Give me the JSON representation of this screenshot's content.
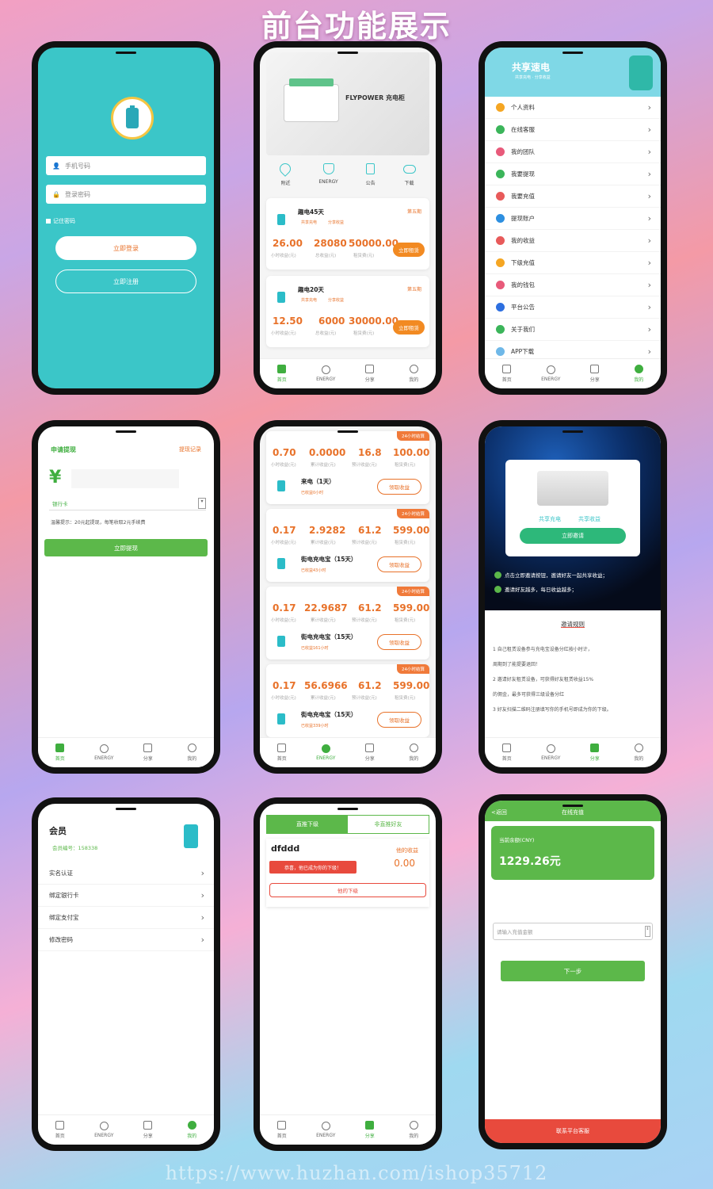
{
  "title": "前台功能展示",
  "watermark": "https://www.huzhan.com/ishop35712",
  "colors": {
    "teal": "#3bc6c8",
    "green": "#5cb84a",
    "orange": "#e8722a",
    "red": "#e84a3d"
  },
  "tabs": [
    "首页",
    "ENERGY",
    "分享",
    "我的"
  ],
  "login": {
    "phone_placeholder": "手机号码",
    "password_placeholder": "登录密码",
    "remember": "记住密码",
    "login_btn": "立即登录",
    "register_btn": "立即注册"
  },
  "home": {
    "banner_brand": "FLYPOWER 充电柜",
    "nav": [
      "附近",
      "ENERGY",
      "公告",
      "下载"
    ],
    "products": [
      {
        "name": "趣电45天",
        "tags": [
          "共享充电",
          "分享收益"
        ],
        "level": "第五期",
        "v1": "26.00",
        "v2": "28080",
        "v3": "50000.00",
        "l1": "小时收益(元)",
        "l2": "总收益(元)",
        "l3": "租赁费(元)",
        "btn": "立即租赁"
      },
      {
        "name": "趣电20天",
        "tags": [
          "共享充电",
          "分享收益"
        ],
        "level": "第五期",
        "v1": "12.50",
        "v2": "6000",
        "v3": "30000.00",
        "l1": "小时收益(元)",
        "l2": "总收益(元)",
        "l3": "租赁费(元)",
        "btn": "立即租赁"
      }
    ]
  },
  "profile": {
    "brand": "共享速电",
    "brand_sub": "共享充电 · 分享收益",
    "menu": [
      "个人资料",
      "在线客服",
      "我的团队",
      "我要提现",
      "我要充值",
      "提现账户",
      "我的收益",
      "下级充值",
      "我的钱包",
      "平台公告",
      "关于我们",
      "APP下载"
    ]
  },
  "withdraw": {
    "title": "申请提现",
    "record": "提现记录",
    "currency": "¥",
    "bank_label": "银行卡",
    "tip": "温馨提示：20元起提现，每笔收取2元手续费",
    "btn": "立即提现"
  },
  "orders": {
    "tag": "24小时结算",
    "labels": [
      "小时收益(元)",
      "累计收益(元)",
      "预计收益(元)",
      "租赁费(元)"
    ],
    "btn": "领取收益",
    "items": [
      {
        "v": [
          "0.70",
          "0.0000",
          "16.8",
          "100.00"
        ],
        "name": "来电（1天）",
        "sub": "已收益0小时"
      },
      {
        "v": [
          "0.17",
          "2.9282",
          "61.2",
          "599.00"
        ],
        "name": "街电充电宝（15天）",
        "sub": "已收益43小时"
      },
      {
        "v": [
          "0.17",
          "22.9687",
          "61.2",
          "599.00"
        ],
        "name": "街电充电宝（15天）",
        "sub": "已收益161小时"
      },
      {
        "v": [
          "0.17",
          "56.6966",
          "61.2",
          "599.00"
        ],
        "name": "街电充电宝（15天）",
        "sub": "已收益339小时"
      }
    ]
  },
  "invite": {
    "card_labels": [
      "共享充电",
      "共享收益"
    ],
    "btn": "立即邀请",
    "steps": [
      "点击立即邀请按钮，邀请好友一起共享收益；",
      "邀请好友越多，每日收益越多；"
    ],
    "rules_title": "邀请规则",
    "rules": [
      "1  自己租赁设备参与充电宝设备分红按小时计，",
      "周期到了能提要退回！",
      "2  邀请好友租赁设备，可获得好友租赁收益15%",
      "的佣金，最多可获得三级设备分红",
      "3  好友扫描二维码注册填写你的手机号即成为你的下级。"
    ]
  },
  "member": {
    "title": "会员",
    "id": "会员编号：158338",
    "items": [
      "实名认证",
      "绑定银行卡",
      "绑定支付宝",
      "修改密码"
    ]
  },
  "team": {
    "tab1": "直推下级",
    "tab2": "非直推好友",
    "user": "dfddd",
    "earn_label": "他的收益",
    "earn": "0.00",
    "notice": "恭喜，他已成为你的下级！",
    "btn": "他的下级"
  },
  "recharge": {
    "back": "<返回",
    "title": "在线充值",
    "bal_label": "当前余额(CNY)",
    "balance": "1229.26元",
    "placeholder": "请输入充值金额",
    "btn": "下一步",
    "footer": "联系平台客服"
  }
}
